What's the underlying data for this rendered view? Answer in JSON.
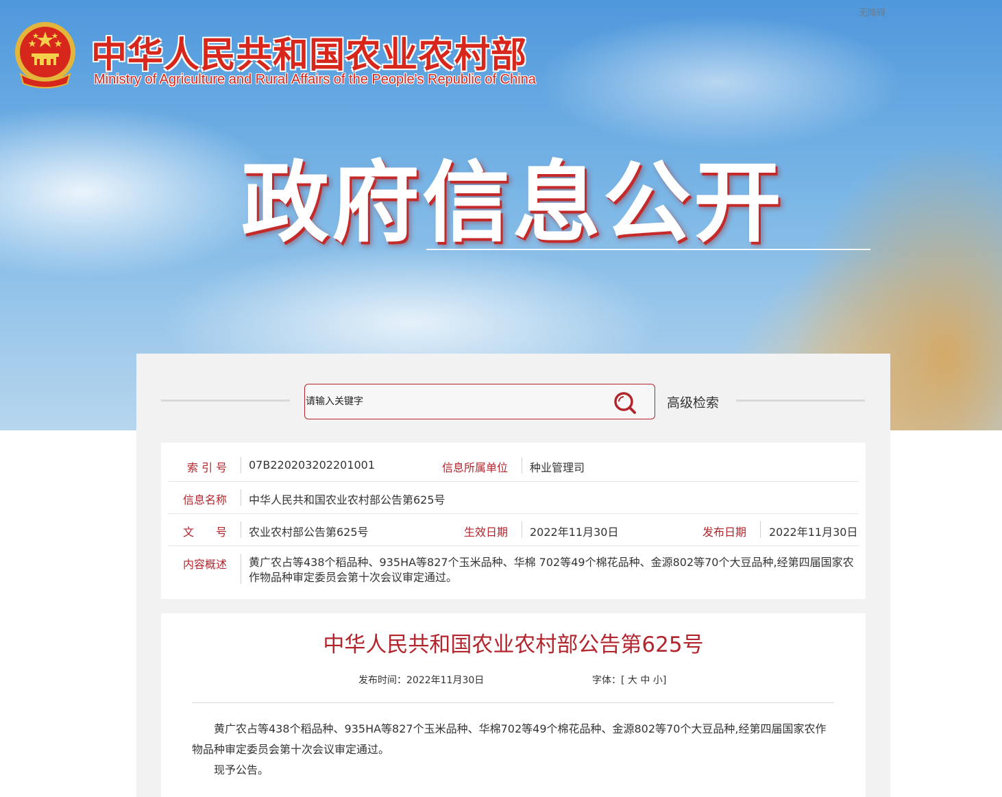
{
  "header": {
    "accessibility_label": "无障碍",
    "ministry_name_cn": "中华人民共和国农业农村部",
    "ministry_name_en": "Ministry of Agriculture and Rural Affairs of the People's Republic of China",
    "banner_title": "政府信息公开"
  },
  "search": {
    "placeholder": "请输入关键字",
    "advanced_label": "高级检索"
  },
  "meta": {
    "index_label": "索 引 号",
    "index_value": "07B220203202201001",
    "unit_label": "信息所属单位",
    "unit_value": "种业管理司",
    "name_label": "信息名称",
    "name_value": "中华人民共和国农业农村部公告第625号",
    "doc_label": "文　　号",
    "doc_value": "农业农村部公告第625号",
    "effective_label": "生效日期",
    "effective_value": "2022年11月30日",
    "publish_label": "发布日期",
    "publish_value": "2022年11月30日",
    "summary_label": "内容概述",
    "summary_value": "黄广农占等438个稻品种、935HA等827个玉米品种、华棉 702等49个棉花品种、金源802等70个大豆品种,经第四届国家农作物品种审定委员会第十次会议审定通过。"
  },
  "article": {
    "title": "中华人民共和国农业农村部公告第625号",
    "publish_time": "发布时间：2022年11月30日",
    "font_label": "字体：[",
    "font_large": "大",
    "font_medium": "中",
    "font_small": "小",
    "font_close": "]",
    "paragraph_1": "黄广农占等438个稻品种、935HA等827个玉米品种、华棉702等49个棉花品种、金源802等70个大豆品种,经第四届国家农作物品种审定委员会第十次会议审定通过。",
    "paragraph_2": "现予公告。"
  },
  "colors": {
    "accent_red": "#b3252c",
    "brand_red": "#d7261b",
    "sky_blue": "#4f98dc"
  }
}
